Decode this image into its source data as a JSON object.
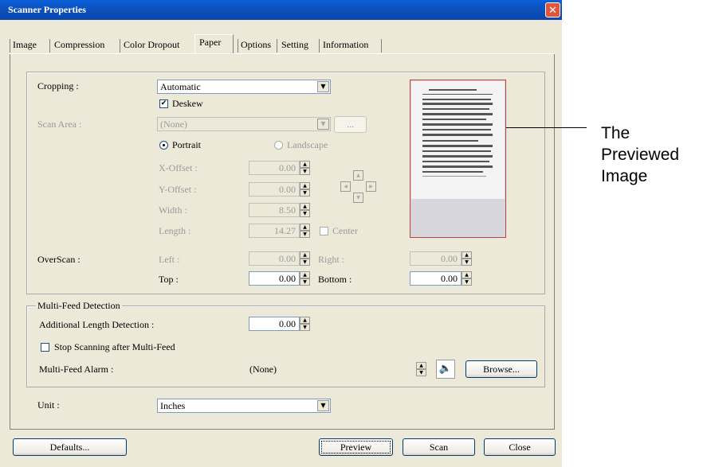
{
  "window": {
    "title": "Scanner Properties",
    "close_glyph": "✕"
  },
  "tabs": [
    {
      "label": "Image"
    },
    {
      "label": "Compression"
    },
    {
      "label": "Color Dropout"
    },
    {
      "label": "Paper",
      "active": true
    },
    {
      "label": "Options"
    },
    {
      "label": "Setting"
    },
    {
      "label": "Information"
    }
  ],
  "paper": {
    "cropping_label": "Cropping :",
    "cropping_value": "Automatic",
    "deskew_label": "Deskew",
    "deskew_checked": true,
    "scan_area_label": "Scan Area :",
    "scan_area_value": "(None)",
    "scan_area_more": "...",
    "portrait_label": "Portrait",
    "landscape_label": "Landscape",
    "orientation": "Portrait",
    "x_offset_label": "X-Offset :",
    "x_offset_value": "0.00",
    "y_offset_label": "Y-Offset :",
    "y_offset_value": "0.00",
    "width_label": "Width :",
    "width_value": "8.50",
    "length_label": "Length :",
    "length_value": "14.27",
    "center_label": "Center",
    "overscan_label": "OverScan :",
    "left_label": "Left :",
    "left_value": "0.00",
    "right_label": "Right :",
    "right_value": "0.00",
    "top_label": "Top :",
    "top_value": "0.00",
    "bottom_label": "Bottom :",
    "bottom_value": "0.00"
  },
  "multifeed": {
    "group_title": "Multi-Feed Detection",
    "additional_length_label": "Additional Length Detection :",
    "additional_length_value": "0.00",
    "stop_scanning_label": "Stop Scanning after Multi-Feed",
    "stop_scanning_checked": false,
    "alarm_label": "Multi-Feed Alarm :",
    "alarm_value": "(None)",
    "browse_label": "Browse..."
  },
  "unit": {
    "label": "Unit :",
    "value": "Inches"
  },
  "buttons": {
    "defaults": "Defaults...",
    "preview": "Preview",
    "scan": "Scan",
    "close": "Close"
  },
  "annotation": {
    "line1": "The",
    "line2": "Previewed",
    "line3": "Image"
  },
  "colors": {
    "titlebar": "#0a5fd8",
    "dialog_bg": "#ece9d8",
    "preview_border": "#c04040"
  }
}
